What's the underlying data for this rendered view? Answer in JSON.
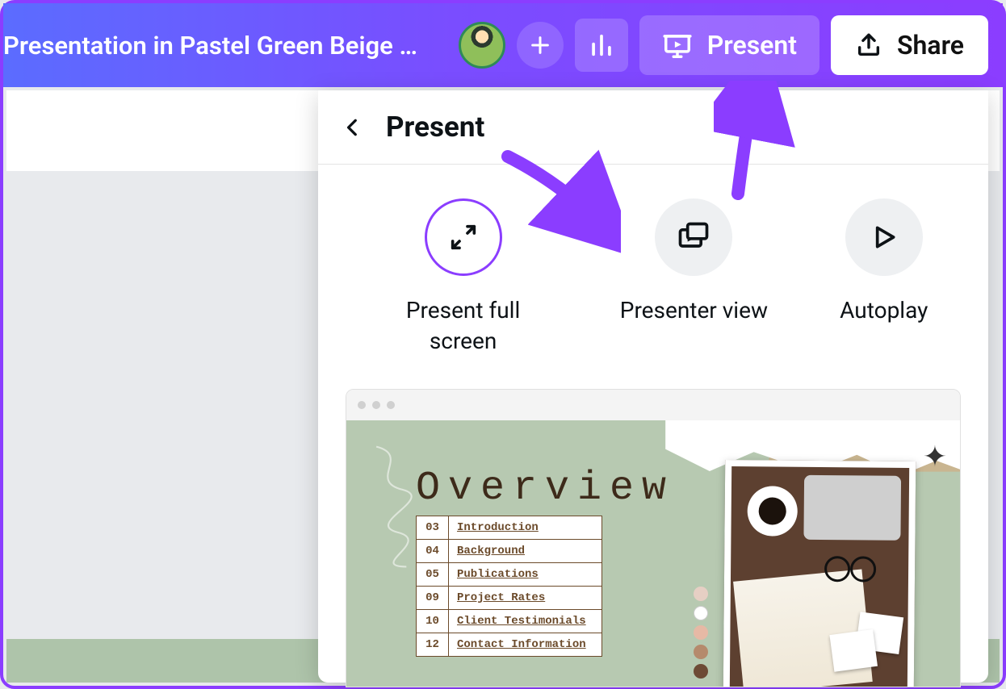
{
  "header": {
    "doc_title": "Presentation in Pastel Green Beige …",
    "present_label": "Present",
    "share_label": "Share"
  },
  "panel": {
    "title": "Present",
    "options": [
      {
        "label": "Present full screen",
        "selected": true
      },
      {
        "label": "Presenter view",
        "selected": false
      },
      {
        "label": "Autoplay",
        "selected": false
      }
    ]
  },
  "slide": {
    "title": "Overview",
    "rows": [
      {
        "num": "03",
        "label": "Introduction"
      },
      {
        "num": "04",
        "label": "Background"
      },
      {
        "num": "05",
        "label": "Publications"
      },
      {
        "num": "09",
        "label": "Project Rates"
      },
      {
        "num": "10",
        "label": "Client Testimonials"
      },
      {
        "num": "12",
        "label": "Contact Information"
      }
    ],
    "palette": [
      "#e6cfc4",
      "#ffffff",
      "#e6b9a5",
      "#b58a6c",
      "#6d4a35"
    ]
  }
}
